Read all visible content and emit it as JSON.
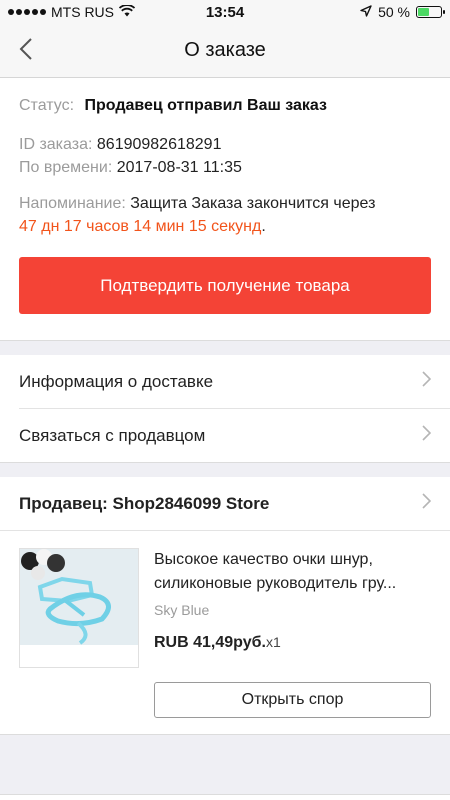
{
  "statusbar": {
    "carrier": "MTS RUS",
    "time": "13:54",
    "battery_text": "50 %",
    "battery_level": 0.5,
    "signal_icon": "signal-dots-icon",
    "wifi_icon": "wifi-icon",
    "location_icon": "location-arrow-icon"
  },
  "navbar": {
    "title": "О заказе",
    "back_icon": "chevron-left-icon"
  },
  "order": {
    "status_label": "Статус:",
    "status_value": "Продавец отправил Ваш заказ",
    "id_label": "ID заказа:",
    "id_value": "86190982618291",
    "time_label": "По времени:",
    "time_value": "2017-08-31 11:35",
    "reminder_label": "Напоминание:",
    "reminder_text": "Защита Заказа закончится через",
    "countdown": "47 дн 17 часов 14 мин 15 секунд",
    "countdown_suffix": ".",
    "confirm_button": "Подтвердить получение товара"
  },
  "links": {
    "delivery": "Информация о доставке",
    "contact_seller": "Связаться с продавцом"
  },
  "seller": {
    "label": "Продавец: Shop2846099 Store"
  },
  "product": {
    "title": "Высокое качество очки шнур, силиконовые руководитель гру...",
    "color": "Sky Blue",
    "price": "RUB 41,49руб.",
    "qty": "x1",
    "dispute_button": "Открыть спор"
  },
  "colors": {
    "accent": "#f44336",
    "countdown": "#f2541b",
    "muted": "#9b9b9b"
  }
}
